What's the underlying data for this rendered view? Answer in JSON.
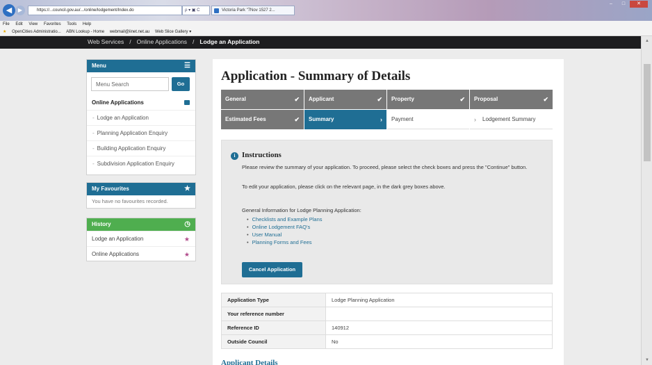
{
  "browser": {
    "address": "https://...council.gov.au/.../online/lodgement/Index.do",
    "address_controls": "ρ ▾ ▣ C",
    "tab_title": "Victoria Park \"7Nov 1527 2...",
    "menubar": [
      "File",
      "Edit",
      "View",
      "Favorites",
      "Tools",
      "Help"
    ],
    "favorites": [
      "OpenCities Administratio...",
      "ABN Lookup - Home",
      "webmail@iinet.net.au",
      "Web Slice Gallery ▾"
    ]
  },
  "breadcrumb": [
    "Web Services",
    "Online Applications",
    "Lodge an Application"
  ],
  "sidebar": {
    "menu": {
      "title": "Menu",
      "search_placeholder": "Menu Search",
      "go_label": "Go",
      "section": "Online Applications",
      "items": [
        "Lodge an Application",
        "Planning Application Enquiry",
        "Building Application Enquiry",
        "Subdivision Application Enquiry"
      ]
    },
    "favourites": {
      "title": "My Favourites",
      "empty_text": "You have no favourites recorded."
    },
    "history": {
      "title": "History",
      "items": [
        "Lodge an Application",
        "Online Applications"
      ]
    }
  },
  "main": {
    "title": "Application - Summary of Details",
    "steps": [
      {
        "label": "General",
        "state": "done",
        "mark": "✔"
      },
      {
        "label": "Applicant",
        "state": "done",
        "mark": "✔"
      },
      {
        "label": "Property",
        "state": "done",
        "mark": "✔"
      },
      {
        "label": "Proposal",
        "state": "done",
        "mark": "✔"
      },
      {
        "label": "Estimated Fees",
        "state": "done",
        "mark": "✔"
      },
      {
        "label": "Summary",
        "state": "active",
        "mark": "›"
      },
      {
        "label": "Payment",
        "state": "todo",
        "mark": "›"
      },
      {
        "label": "Lodgement Summary",
        "state": "todo",
        "mark": "›"
      }
    ],
    "instructions": {
      "title": "Instructions",
      "p1": "Please review the summary of your application. To proceed, please select the check boxes and press the \"Continue\" button.",
      "p2": "To edit your application, please click on the relevant page, in the dark grey boxes above.",
      "p3": "General Information for Lodge Planning Application:",
      "links": [
        "Checklists and Example Plans",
        "Online Lodgement FAQ's",
        "User Manual",
        "Planning Forms and Fees"
      ],
      "cancel_label": "Cancel Application"
    },
    "details": [
      {
        "label": "Application Type",
        "value": "Lodge Planning Application"
      },
      {
        "label": "Your reference number",
        "value": ""
      },
      {
        "label": "Reference ID",
        "value": "140912"
      },
      {
        "label": "Outside Council",
        "value": "No"
      }
    ],
    "next_section": "Applicant Details"
  },
  "colors": {
    "primary": "#1f6e94",
    "history": "#4fae4f",
    "step_done": "#777777",
    "header": "#1d1d1f"
  }
}
